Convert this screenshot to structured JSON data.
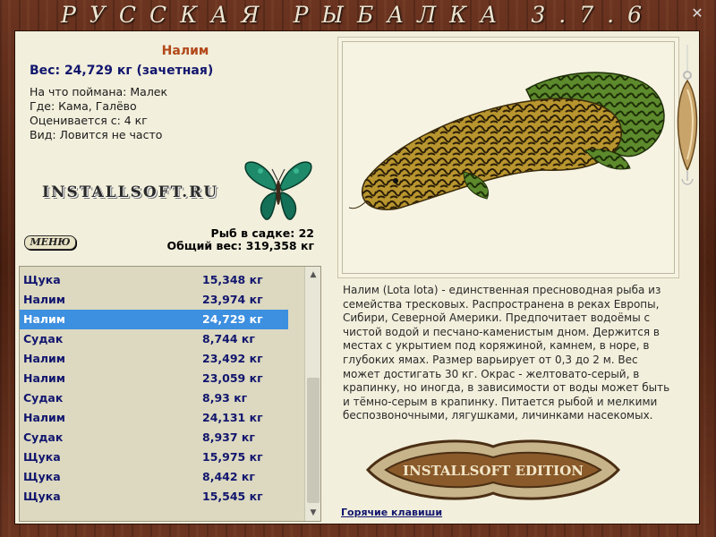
{
  "window": {
    "title": "РУССКАЯ РЫБАЛКА 3.7.6",
    "close_glyph": "✕"
  },
  "catch": {
    "name": "Налим",
    "weight_line": "Вес: 24,729 кг (зачетная)",
    "info": [
      "На что поймана: Малек",
      "Где: Кама, Галёво",
      "Оценивается с: 4 кг",
      "Вид: Ловится не часто"
    ]
  },
  "logo": {
    "text": "INSTALLSOFT.RU"
  },
  "menu": {
    "label": "МЕНЮ"
  },
  "keepnet": {
    "count_line": "Рыб в садке: 22",
    "total_line": "Общий вес: 319,358 кг"
  },
  "fish_list": [
    {
      "name": "Щука",
      "weight": "15,348 кг"
    },
    {
      "name": "Налим",
      "weight": "23,974 кг"
    },
    {
      "name": "Налим",
      "weight": "24,729 кг",
      "selected": true
    },
    {
      "name": "Судак",
      "weight": "8,744 кг"
    },
    {
      "name": "Налим",
      "weight": "23,492 кг"
    },
    {
      "name": "Налим",
      "weight": "23,059 кг"
    },
    {
      "name": "Судак",
      "weight": "8,93 кг"
    },
    {
      "name": "Налим",
      "weight": "24,131 кг"
    },
    {
      "name": "Судак",
      "weight": "8,937 кг"
    },
    {
      "name": "Щука",
      "weight": "15,975 кг"
    },
    {
      "name": "Щука",
      "weight": "8,442 кг"
    },
    {
      "name": "Щука",
      "weight": "15,545 кг"
    }
  ],
  "description": "Налим (Lota lota) - единственная пресноводная рыба из семейства тресковых. Распространена в реках Европы, Сибири, Северной Америки. Предпочитает водоёмы с чистой водой и песчано-каменистым дном. Держится в местах с укрытием под коряжиной, камнем, в норе, в глубоких ямах. Размер варьирует от 0,3 до 2 м. Вес может достигать 30 кг. Окрас - желтовато-серый, в крапинку, но иногда, в зависимости от воды может быть и тёмно-серым в крапинку. Питается рыбой и мелкими беспозвоночными, лягушками, личинками насекомых.",
  "edition_logo": "INSTALLSOFT EDITION",
  "hotkeys": {
    "label": "Горячие клавиши"
  },
  "colors": {
    "accent_name": "#b2481a",
    "list_text": "#12166e",
    "selection": "#3d8fe0",
    "panel_bg": "#f2efdc",
    "frame_wood": "#5a2a17"
  }
}
